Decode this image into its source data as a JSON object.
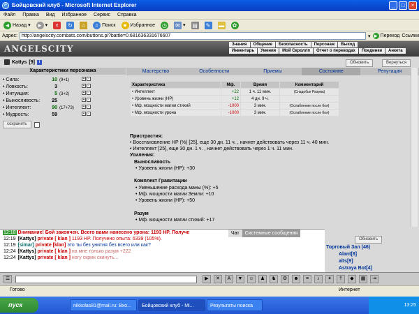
{
  "window": {
    "title": "Бойцовский клуб - Microsoft Internet Explorer"
  },
  "menu": [
    "Файл",
    "Правка",
    "Вид",
    "Избранное",
    "Сервис",
    "Справка"
  ],
  "toolbar": {
    "back": "Назад",
    "search": "Поиск",
    "favorites": "Избранное"
  },
  "address": {
    "label": "Адрес:",
    "url": "http://angelscity.combats.com/buttons.pl?battle=0.681636331676607",
    "go": "Переход",
    "links": "Ссылки"
  },
  "game": {
    "logo": "ANGELSCITY",
    "nav_top": [
      "Знания",
      "Общение",
      "Безопасность",
      "Персонаж",
      "Выход"
    ],
    "nav_bottom": [
      "Инвентарь",
      "Умения",
      "Мой Скроллп",
      "Отчет о переводах",
      "Поединки",
      "Анкета"
    ],
    "player": {
      "name": "Kattys",
      "level": "[9]"
    },
    "refresh": "Обновить",
    "back": "Вернуться",
    "stats_title": "Характеристики персонажа",
    "stats": [
      {
        "name": "• Сила:",
        "value": "10",
        "bonus": "(9+1)"
      },
      {
        "name": "• Ловкость:",
        "value": "3",
        "bonus": ""
      },
      {
        "name": "• Интуиция:",
        "value": "5",
        "bonus": "(3+2)"
      },
      {
        "name": "• Выносливость:",
        "value": "25",
        "bonus": ""
      },
      {
        "name": "• Интеллект:",
        "value": "90",
        "bonus": "(17+73)"
      },
      {
        "name": "• Мудрость:",
        "value": "59",
        "bonus": ""
      }
    ],
    "save": "сохранить",
    "tabs": [
      "Мастерство",
      "Особенности",
      "Приемы",
      "Состояние",
      "Репутация"
    ],
    "table": {
      "headers": [
        "Характеристика",
        "Мф.",
        "Время",
        "Комментарий"
      ],
      "rows": [
        {
          "name": "• Интеллект",
          "mf": "+22",
          "time": "1 ч. 11 мин.",
          "comment": "(Снадобье Разума)"
        },
        {
          "name": "• Уровень жизни (НР)",
          "mf": "+12",
          "time": "4 дн. 9 ч.",
          "comment": ""
        },
        {
          "name": "• Мф. мощности магии стихий",
          "mf": "-1000",
          "time": "3 мин.",
          "comment": "(Ослабление после боя)"
        },
        {
          "name": "• Мф. мощности урона",
          "mf": "-1000",
          "time": "3 мин.",
          "comment": "(Ослабление после боя)"
        }
      ]
    },
    "pristrastia_title": "Пристрастия:",
    "pristrastia": [
      "• Восстановление НР (%) [25], еще 30 дн. 11 ч. , начнет действовать через 11 ч. 40 мин.",
      "• Интеллект [25], еще 30 дн. 1 ч. , начнет действовать через 1 ч. 11 мин."
    ],
    "usilenia_title": "Усиления:",
    "groups": [
      {
        "title": "Выносливость",
        "items": [
          "• Уровень жизни (НР): +30"
        ]
      },
      {
        "title": "Комплект Гравитации",
        "items": [
          "• Уменьшение расхода маны (%): +5",
          "• Мф. мощности магии Земли: +10",
          "• Уровень жизни (НР): +50"
        ]
      },
      {
        "title": "Разум",
        "items": [
          "• Мф. мощности магии стихий: +17"
        ]
      }
    ]
  },
  "chat": {
    "tabs": [
      "Чат",
      "Системные сообщения"
    ],
    "lines": [
      {
        "time": "12:18",
        "author": "",
        "text": "Внимание! Бой закончен. Всего вами нанесено урона: 1193 HP. Получе"
      },
      {
        "time": "12:19",
        "author": "[Kattys]",
        "private": "private [ klan ]",
        "text": "1193 HP. Получено опыта: 6339 (105%)."
      },
      {
        "time": "12:19",
        "author": "[simar]",
        "private": "private [klan]",
        "text": "это ты без унития без всего или как?"
      },
      {
        "time": "12:24",
        "author": "[Kattys]",
        "private": "private [ klan ]",
        "text": "на мне только разум +222"
      },
      {
        "time": "12:24",
        "author": "[Kattys]",
        "private": "private [ klan ]",
        "text": "ногу скрин скинуть..."
      }
    ],
    "room_refresh": "Обновить",
    "room_title": "Торговый Зал (46)",
    "users": [
      "Alant[8]",
      "alts[9]",
      "Astraya Bot[4]"
    ]
  },
  "status": {
    "text": "Готово",
    "zone": "Интернет"
  },
  "taskbar": {
    "start": "пуск",
    "tasks": [
      "nikkolas81@mail.ru: Вхо...",
      "Бойцовский клуб - Mi...",
      "Результаты поиска"
    ],
    "clock": "13:25"
  }
}
